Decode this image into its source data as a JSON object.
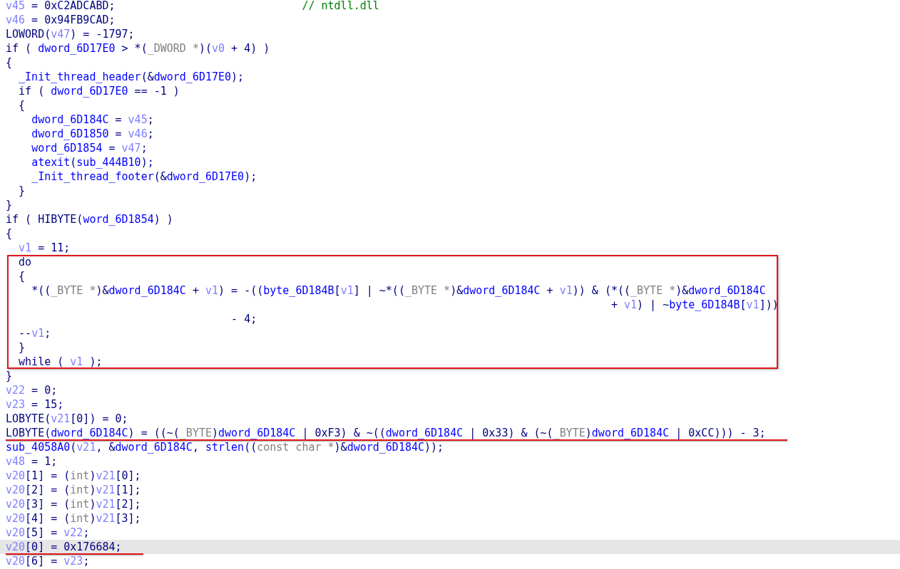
{
  "blocks": [
    {
      "kind": "code",
      "lines": [
        {
          "selected": false,
          "underlined": false,
          "segments": [
            {
              "kind": "local",
              "text": "v45"
            },
            {
              "kind": "plain",
              "text": " = 0xC2ADCABD;                             "
            },
            {
              "kind": "comment",
              "text": "// ntdll.dll"
            }
          ]
        },
        {
          "selected": false,
          "underlined": false,
          "segments": [
            {
              "kind": "local",
              "text": "v46"
            },
            {
              "kind": "plain",
              "text": " = 0x94FB9CAD;"
            }
          ]
        },
        {
          "selected": false,
          "underlined": false,
          "segments": [
            {
              "kind": "plain",
              "text": "LOWORD("
            },
            {
              "kind": "local",
              "text": "v47"
            },
            {
              "kind": "plain",
              "text": ") = -1797;"
            }
          ]
        },
        {
          "selected": false,
          "underlined": false,
          "segments": [
            {
              "kind": "plain",
              "text": "if ( "
            },
            {
              "kind": "global",
              "text": "dword_6D17E0"
            },
            {
              "kind": "plain",
              "text": " > *("
            },
            {
              "kind": "type",
              "text": "_DWORD *"
            },
            {
              "kind": "plain",
              "text": ")("
            },
            {
              "kind": "local",
              "text": "v0"
            },
            {
              "kind": "plain",
              "text": " + 4) )"
            }
          ]
        },
        {
          "selected": false,
          "underlined": false,
          "segments": [
            {
              "kind": "plain",
              "text": "{"
            }
          ]
        },
        {
          "selected": false,
          "underlined": false,
          "segments": [
            {
              "kind": "global",
              "text": "  _Init_thread_header"
            },
            {
              "kind": "plain",
              "text": "(&"
            },
            {
              "kind": "global",
              "text": "dword_6D17E0"
            },
            {
              "kind": "plain",
              "text": ");"
            }
          ]
        },
        {
          "selected": false,
          "underlined": false,
          "segments": [
            {
              "kind": "plain",
              "text": "  if ( "
            },
            {
              "kind": "global",
              "text": "dword_6D17E0"
            },
            {
              "kind": "plain",
              "text": " == -1 )"
            }
          ]
        },
        {
          "selected": false,
          "underlined": false,
          "segments": [
            {
              "kind": "plain",
              "text": "  {"
            }
          ]
        },
        {
          "selected": false,
          "underlined": false,
          "segments": [
            {
              "kind": "global",
              "text": "    dword_6D184C"
            },
            {
              "kind": "plain",
              "text": " = "
            },
            {
              "kind": "local",
              "text": "v45"
            },
            {
              "kind": "plain",
              "text": ";"
            }
          ]
        },
        {
          "selected": false,
          "underlined": false,
          "segments": [
            {
              "kind": "global",
              "text": "    dword_6D1850"
            },
            {
              "kind": "plain",
              "text": " = "
            },
            {
              "kind": "local",
              "text": "v46"
            },
            {
              "kind": "plain",
              "text": ";"
            }
          ]
        },
        {
          "selected": false,
          "underlined": false,
          "segments": [
            {
              "kind": "global",
              "text": "    word_6D1854"
            },
            {
              "kind": "plain",
              "text": " = "
            },
            {
              "kind": "local",
              "text": "v47"
            },
            {
              "kind": "plain",
              "text": ";"
            }
          ]
        },
        {
          "selected": false,
          "underlined": false,
          "segments": [
            {
              "kind": "global",
              "text": "    atexit"
            },
            {
              "kind": "plain",
              "text": "("
            },
            {
              "kind": "global",
              "text": "sub_444B10"
            },
            {
              "kind": "plain",
              "text": ");"
            }
          ]
        },
        {
          "selected": false,
          "underlined": false,
          "segments": [
            {
              "kind": "global",
              "text": "    _Init_thread_footer"
            },
            {
              "kind": "plain",
              "text": "(&"
            },
            {
              "kind": "global",
              "text": "dword_6D17E0"
            },
            {
              "kind": "plain",
              "text": ");"
            }
          ]
        },
        {
          "selected": false,
          "underlined": false,
          "segments": [
            {
              "kind": "plain",
              "text": "  }"
            }
          ]
        },
        {
          "selected": false,
          "underlined": false,
          "segments": [
            {
              "kind": "plain",
              "text": "}"
            }
          ]
        },
        {
          "selected": false,
          "underlined": false,
          "segments": [
            {
              "kind": "plain",
              "text": "if ( HIBYTE("
            },
            {
              "kind": "global",
              "text": "word_6D1854"
            },
            {
              "kind": "plain",
              "text": ") )"
            }
          ]
        },
        {
          "selected": false,
          "underlined": false,
          "segments": [
            {
              "kind": "plain",
              "text": "{"
            }
          ]
        },
        {
          "selected": false,
          "underlined": false,
          "segments": [
            {
              "kind": "local",
              "text": "  v1"
            },
            {
              "kind": "plain",
              "text": " = 11;"
            }
          ]
        }
      ]
    },
    {
      "kind": "boxed",
      "lines": [
        {
          "selected": false,
          "underlined": false,
          "segments": [
            {
              "kind": "plain",
              "text": "  do"
            }
          ]
        },
        {
          "selected": false,
          "underlined": false,
          "segments": [
            {
              "kind": "plain",
              "text": "  {"
            }
          ]
        },
        {
          "selected": false,
          "underlined": false,
          "segments": [
            {
              "kind": "plain",
              "text": "    *(("
            },
            {
              "kind": "type",
              "text": "_BYTE *"
            },
            {
              "kind": "plain",
              "text": ")&"
            },
            {
              "kind": "global",
              "text": "dword_6D184C"
            },
            {
              "kind": "plain",
              "text": " + "
            },
            {
              "kind": "local",
              "text": "v1"
            },
            {
              "kind": "plain",
              "text": ") = -(("
            },
            {
              "kind": "global",
              "text": "byte_6D184B"
            },
            {
              "kind": "plain",
              "text": "["
            },
            {
              "kind": "local",
              "text": "v1"
            },
            {
              "kind": "plain",
              "text": "] | ~*(("
            },
            {
              "kind": "type",
              "text": "_BYTE *"
            },
            {
              "kind": "plain",
              "text": ")&"
            },
            {
              "kind": "global",
              "text": "dword_6D184C"
            },
            {
              "kind": "plain",
              "text": " + "
            },
            {
              "kind": "local",
              "text": "v1"
            },
            {
              "kind": "plain",
              "text": ")) & (*(("
            },
            {
              "kind": "type",
              "text": "_BYTE *"
            },
            {
              "kind": "plain",
              "text": ")&"
            },
            {
              "kind": "global",
              "text": "dword_6D184C"
            }
          ]
        },
        {
          "selected": false,
          "underlined": false,
          "segments": [
            {
              "kind": "plain",
              "text": "                                                                                              + "
            },
            {
              "kind": "local",
              "text": "v1"
            },
            {
              "kind": "plain",
              "text": ") | ~"
            },
            {
              "kind": "global",
              "text": "byte_6D184B"
            },
            {
              "kind": "plain",
              "text": "["
            },
            {
              "kind": "local",
              "text": "v1"
            },
            {
              "kind": "plain",
              "text": "]))"
            }
          ]
        },
        {
          "selected": false,
          "underlined": false,
          "segments": [
            {
              "kind": "plain",
              "text": "                                   - 4;"
            }
          ]
        },
        {
          "selected": false,
          "underlined": false,
          "segments": [
            {
              "kind": "plain",
              "text": "  --"
            },
            {
              "kind": "local",
              "text": "v1"
            },
            {
              "kind": "plain",
              "text": ";"
            }
          ]
        },
        {
          "selected": false,
          "underlined": false,
          "segments": [
            {
              "kind": "plain",
              "text": "  }"
            }
          ]
        },
        {
          "selected": false,
          "underlined": false,
          "segments": [
            {
              "kind": "plain",
              "text": "  while ( "
            },
            {
              "kind": "local",
              "text": "v1"
            },
            {
              "kind": "plain",
              "text": " );"
            }
          ]
        }
      ]
    },
    {
      "kind": "code",
      "lines": [
        {
          "selected": false,
          "underlined": false,
          "segments": [
            {
              "kind": "plain",
              "text": "}"
            }
          ]
        },
        {
          "selected": false,
          "underlined": false,
          "segments": [
            {
              "kind": "local",
              "text": "v22"
            },
            {
              "kind": "plain",
              "text": " = 0;"
            }
          ]
        },
        {
          "selected": false,
          "underlined": false,
          "segments": [
            {
              "kind": "local",
              "text": "v23"
            },
            {
              "kind": "plain",
              "text": " = 15;"
            }
          ]
        },
        {
          "selected": false,
          "underlined": false,
          "segments": [
            {
              "kind": "plain",
              "text": "LOBYTE("
            },
            {
              "kind": "local",
              "text": "v21"
            },
            {
              "kind": "plain",
              "text": "[0]) = 0;"
            }
          ]
        },
        {
          "selected": false,
          "underlined": true,
          "segments": [
            {
              "kind": "plain",
              "text": "LOBYTE("
            },
            {
              "kind": "global",
              "text": "dword_6D184C"
            },
            {
              "kind": "plain",
              "text": ") = ((~("
            },
            {
              "kind": "type",
              "text": "_BYTE"
            },
            {
              "kind": "plain",
              "text": ")"
            },
            {
              "kind": "global",
              "text": "dword_6D184C"
            },
            {
              "kind": "plain",
              "text": " | 0xF3) & ~(("
            },
            {
              "kind": "global",
              "text": "dword_6D184C"
            },
            {
              "kind": "plain",
              "text": " | 0x33) & (~("
            },
            {
              "kind": "type",
              "text": "_BYTE"
            },
            {
              "kind": "plain",
              "text": ")"
            },
            {
              "kind": "global",
              "text": "dword_6D184C"
            },
            {
              "kind": "plain",
              "text": " | 0xCC))) - 3;"
            }
          ]
        },
        {
          "selected": false,
          "underlined": false,
          "segments": [
            {
              "kind": "global",
              "text": "sub_4058A0"
            },
            {
              "kind": "plain",
              "text": "("
            },
            {
              "kind": "local",
              "text": "v21"
            },
            {
              "kind": "plain",
              "text": ", &"
            },
            {
              "kind": "global",
              "text": "dword_6D184C"
            },
            {
              "kind": "plain",
              "text": ", "
            },
            {
              "kind": "global",
              "text": "strlen"
            },
            {
              "kind": "plain",
              "text": "(("
            },
            {
              "kind": "type",
              "text": "const char *"
            },
            {
              "kind": "plain",
              "text": ")&"
            },
            {
              "kind": "global",
              "text": "dword_6D184C"
            },
            {
              "kind": "plain",
              "text": "));"
            }
          ]
        },
        {
          "selected": false,
          "underlined": false,
          "segments": [
            {
              "kind": "local",
              "text": "v48"
            },
            {
              "kind": "plain",
              "text": " = 1;"
            }
          ]
        },
        {
          "selected": false,
          "underlined": false,
          "segments": [
            {
              "kind": "local",
              "text": "v20"
            },
            {
              "kind": "plain",
              "text": "[1] = ("
            },
            {
              "kind": "type",
              "text": "int"
            },
            {
              "kind": "plain",
              "text": ")"
            },
            {
              "kind": "local",
              "text": "v21"
            },
            {
              "kind": "plain",
              "text": "[0];"
            }
          ]
        },
        {
          "selected": false,
          "underlined": false,
          "segments": [
            {
              "kind": "local",
              "text": "v20"
            },
            {
              "kind": "plain",
              "text": "[2] = ("
            },
            {
              "kind": "type",
              "text": "int"
            },
            {
              "kind": "plain",
              "text": ")"
            },
            {
              "kind": "local",
              "text": "v21"
            },
            {
              "kind": "plain",
              "text": "[1];"
            }
          ]
        },
        {
          "selected": false,
          "underlined": false,
          "segments": [
            {
              "kind": "local",
              "text": "v20"
            },
            {
              "kind": "plain",
              "text": "[3] = ("
            },
            {
              "kind": "type",
              "text": "int"
            },
            {
              "kind": "plain",
              "text": ")"
            },
            {
              "kind": "local",
              "text": "v21"
            },
            {
              "kind": "plain",
              "text": "[2];"
            }
          ]
        },
        {
          "selected": false,
          "underlined": false,
          "segments": [
            {
              "kind": "local",
              "text": "v20"
            },
            {
              "kind": "plain",
              "text": "[4] = ("
            },
            {
              "kind": "type",
              "text": "int"
            },
            {
              "kind": "plain",
              "text": ")"
            },
            {
              "kind": "local",
              "text": "v21"
            },
            {
              "kind": "plain",
              "text": "[3];"
            }
          ]
        },
        {
          "selected": false,
          "underlined": false,
          "segments": [
            {
              "kind": "local",
              "text": "v20"
            },
            {
              "kind": "plain",
              "text": "[5] = "
            },
            {
              "kind": "local",
              "text": "v22"
            },
            {
              "kind": "plain",
              "text": ";"
            }
          ]
        },
        {
          "selected": true,
          "underlined": true,
          "segments": [
            {
              "kind": "local",
              "text": "v20"
            },
            {
              "kind": "plain",
              "text": "[0] = 0x176684;"
            }
          ]
        },
        {
          "selected": false,
          "underlined": false,
          "segments": [
            {
              "kind": "local",
              "text": "v20"
            },
            {
              "kind": "plain",
              "text": "[6] = "
            },
            {
              "kind": "local",
              "text": "v23"
            },
            {
              "kind": "plain",
              "text": ";"
            }
          ]
        }
      ]
    }
  ]
}
